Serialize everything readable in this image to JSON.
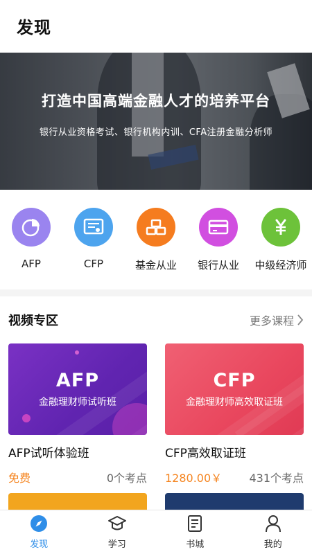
{
  "header": {
    "title": "发现"
  },
  "banner": {
    "title": "打造中国高端金融人才的培养平台",
    "subtitle": "银行从业资格考试、银行机构内训、CFA注册金融分析师"
  },
  "categories": [
    {
      "label": "AFP",
      "icon": "pie-chart-icon",
      "color": "#9a84ef"
    },
    {
      "label": "CFP",
      "icon": "certificate-icon",
      "color": "#4da4ee"
    },
    {
      "label": "基金从业",
      "icon": "gold-bars-icon",
      "color": "#f57c1f"
    },
    {
      "label": "银行从业",
      "icon": "bank-card-icon",
      "color": "#d14fe0"
    },
    {
      "label": "中级经济师",
      "icon": "currency-icon",
      "color": "#6dc23a"
    }
  ],
  "video_section": {
    "title": "视频专区",
    "more_label": "更多课程"
  },
  "courses": [
    {
      "cover_title": "AFP",
      "cover_subtitle": "金融理财师试听班",
      "name": "AFP试听体验班",
      "price": "免费",
      "points": "0个考点",
      "cover_color": "#6a28b8"
    },
    {
      "cover_title": "CFP",
      "cover_subtitle": "金融理财师高效取证班",
      "name": "CFP高效取证班",
      "price": "1280.00￥",
      "points": "431个考点",
      "cover_color": "#e8465d"
    }
  ],
  "tabs": [
    {
      "label": "发现",
      "icon": "compass-icon",
      "active": true
    },
    {
      "label": "学习",
      "icon": "graduation-cap-icon",
      "active": false
    },
    {
      "label": "书城",
      "icon": "book-icon",
      "active": false
    },
    {
      "label": "我的",
      "icon": "user-icon",
      "active": false
    }
  ],
  "colors": {
    "accent": "#2f8ee8",
    "price": "#f5841f"
  }
}
